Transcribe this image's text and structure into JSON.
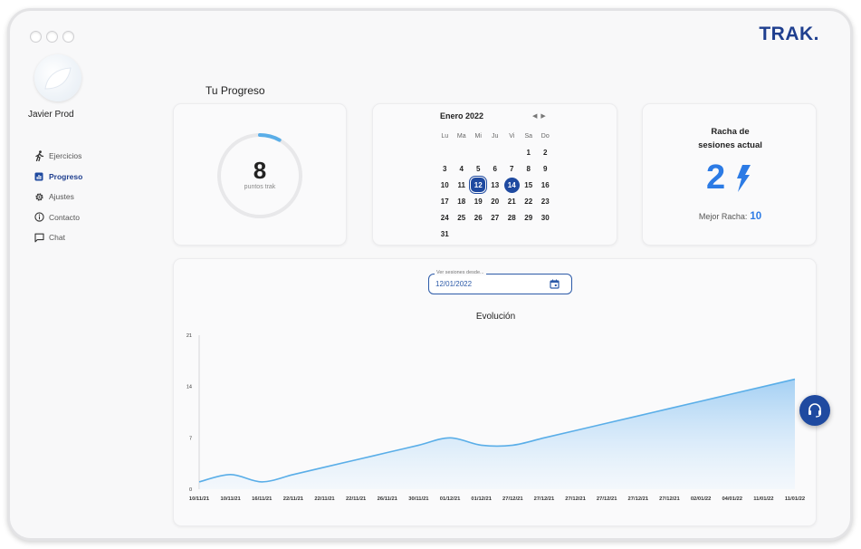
{
  "app": {
    "logo": "TRAK."
  },
  "user": {
    "name": "Javier Prod"
  },
  "sidebar": {
    "items": [
      {
        "label": "Ejercicios",
        "icon": "walking-person-icon",
        "active": false
      },
      {
        "label": "Progreso",
        "icon": "bar-chart-icon",
        "active": true
      },
      {
        "label": "Ajustes",
        "icon": "gear-icon",
        "active": false
      },
      {
        "label": "Contacto",
        "icon": "info-icon",
        "active": false
      },
      {
        "label": "Chat",
        "icon": "chat-bubble-icon",
        "active": false
      }
    ]
  },
  "page": {
    "title": "Tu Progreso"
  },
  "points": {
    "value": "8",
    "label": "puntos trak",
    "progress": 0.08
  },
  "calendar": {
    "month": "Enero 2022",
    "weekdays": [
      "Lu",
      "Ma",
      "Mi",
      "Ju",
      "Vi",
      "Sa",
      "Do"
    ],
    "first_offset": 5,
    "days": [
      "1",
      "2",
      "3",
      "4",
      "5",
      "6",
      "7",
      "8",
      "9",
      "10",
      "11",
      "12",
      "13",
      "14",
      "15",
      "16",
      "17",
      "18",
      "19",
      "20",
      "21",
      "22",
      "23",
      "24",
      "25",
      "26",
      "27",
      "28",
      "29",
      "30",
      "31"
    ],
    "selected_day": "12",
    "today": "14"
  },
  "streak": {
    "title_line1": "Racha de",
    "title_line2": "sesiones actual",
    "value": "2",
    "best_label": "Mejor Racha:",
    "best_value": "10"
  },
  "filter": {
    "label": "Ver sesiones desde...",
    "value": "12/01/2022"
  },
  "colors": {
    "primary": "#1f4aa0",
    "accent": "#2c7be5",
    "line": "#5aaee8"
  },
  "chart_data": {
    "type": "area",
    "title": "Evolución",
    "y_ticks": [
      "0",
      "7",
      "14",
      "21"
    ],
    "ylim": [
      0,
      21
    ],
    "x": [
      "10/11/21",
      "10/11/21",
      "16/11/21",
      "22/11/21",
      "22/11/21",
      "22/11/21",
      "26/11/21",
      "30/11/21",
      "01/12/21",
      "01/12/21",
      "27/12/21",
      "27/12/21",
      "27/12/21",
      "27/12/21",
      "27/12/21",
      "27/12/21",
      "02/01/22",
      "04/01/22",
      "11/01/22",
      "11/01/22"
    ],
    "values": [
      1,
      2,
      1,
      2,
      3,
      4,
      5,
      6,
      7,
      6,
      6,
      7,
      8,
      9,
      10,
      11,
      12,
      13,
      14,
      15
    ],
    "grid": false,
    "legend": "none"
  }
}
